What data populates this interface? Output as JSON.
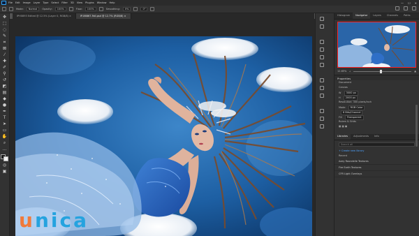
{
  "menu": {
    "items": [
      "File",
      "Edit",
      "Image",
      "Layer",
      "Type",
      "Select",
      "Filter",
      "3D",
      "View",
      "Plugins",
      "Window",
      "Help"
    ],
    "window_controls": [
      "—",
      "☐",
      "✕"
    ]
  },
  "options_bar": {
    "mode_label": "Mode:",
    "mode_value": "Normal",
    "opacity_label": "Opacity:",
    "opacity_value": "100%",
    "flow_label": "Flow:",
    "flow_value": "100%",
    "smoothing_label": "Smoothing:",
    "smoothing_value": "0%",
    "angle_value": "0°"
  },
  "tabs": [
    {
      "label": "IPH0893 Edited @ 12.5% (Layer 0, RGB/8) ×"
    },
    {
      "label": "IP-86867-Fall.psd @ 12.7% (RGB/8) ×"
    }
  ],
  "panels": {
    "top_tabs": [
      "Histogram",
      "Navigator",
      "Layers",
      "Channels",
      "Paths"
    ],
    "zoom_value": "12.65%",
    "properties_tab": "Properties",
    "document_label": "Document",
    "canvas_header": "Canvas",
    "width_label": "W",
    "width_value": "3000 px",
    "height_label": "H",
    "height_value": "2000 px",
    "resolution": "Resolution: 300 pixels/inch",
    "mode_label": "Mode",
    "mode_value": "RGB Color",
    "bits_value": "8 Bits/Channel",
    "fill_label": "Fill",
    "fill_value": "Transparent",
    "rulers_header": "Rulers & Grids",
    "libraries_tabs": [
      "Libraries",
      "Adjustments",
      "Info"
    ],
    "search_placeholder": "Search all",
    "create_library": "+ Create new library",
    "recent_label": "Recent",
    "lib_items": [
      "Azey Roundelle Textures",
      "Fire Earth Textures",
      "CFR Light Overlays"
    ]
  },
  "logo": {
    "first": "u",
    "rest": "nica"
  },
  "colors": {
    "brand_orange": "#f07a3b",
    "brand_blue": "#25a3df",
    "ps_dark": "#323232"
  }
}
